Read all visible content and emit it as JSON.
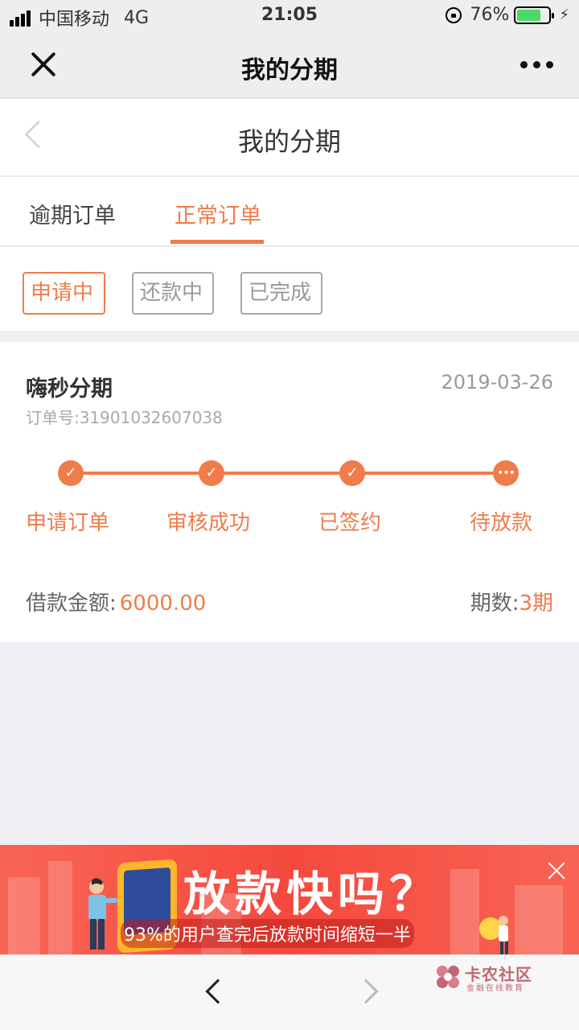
{
  "status_bar": {
    "carrier": "中国移动",
    "network": "4G",
    "time": "21:05",
    "battery": "76%",
    "battery_level": 0.76
  },
  "wechat_header": {
    "title": "我的分期"
  },
  "page_header": {
    "title": "我的分期"
  },
  "tabs": {
    "overdue": "逾期订单",
    "normal": "正常订单",
    "active": "正常订单"
  },
  "filters": {
    "applying": "申请中",
    "repaying": "还款中",
    "completed": "已完成",
    "active": "申请中"
  },
  "order": {
    "merchant": "嗨秒分期",
    "date": "2019-03-26",
    "order_no": "订单号:31901032607038",
    "steps": [
      "申请订单",
      "审核成功",
      "已签约",
      "待放款"
    ],
    "amount_label": "借款金额:",
    "amount_value": "6000.00",
    "period_label": "期数:",
    "period_value": "3期"
  },
  "ad": {
    "title": "放款快吗？",
    "subtitle": "93%的用户查完后放款时间缩短一半"
  },
  "watermark": {
    "name": "卡农社区",
    "sub": "金融在线教育"
  },
  "colors": {
    "accent": "#ef7c4a",
    "ad_red": "#f5493e",
    "battery_green": "#4cd964"
  }
}
